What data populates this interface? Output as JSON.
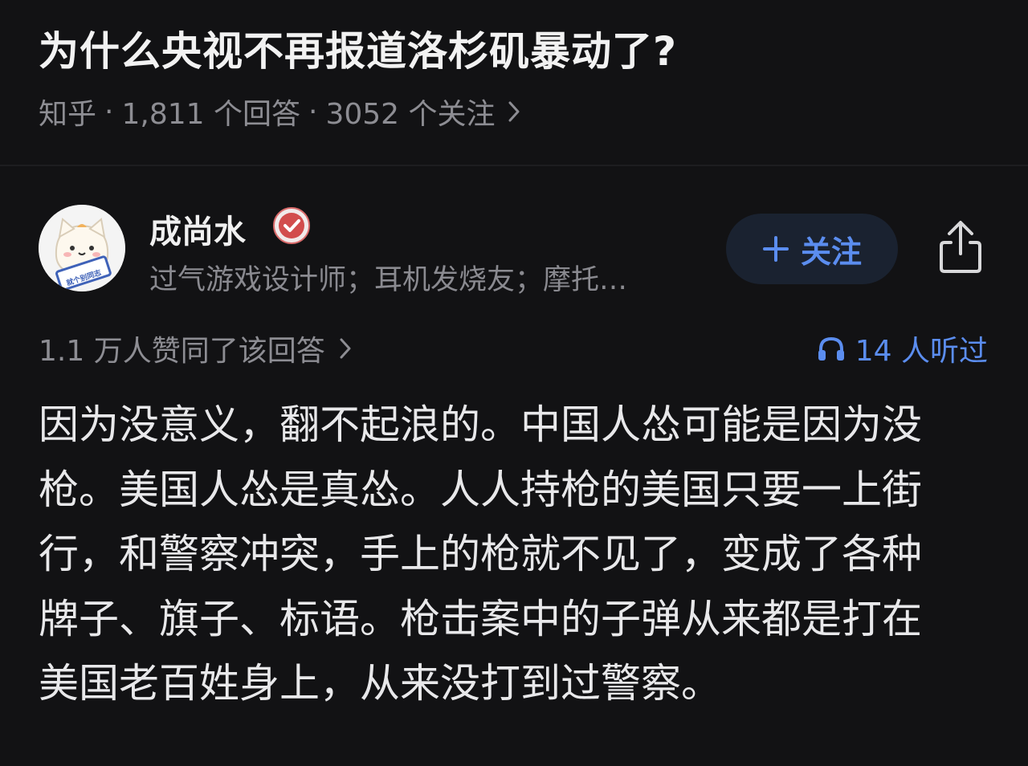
{
  "question": {
    "title": "为什么央视不再报道洛杉矶暴动了?"
  },
  "meta": {
    "source": "知乎",
    "separator": "·",
    "answer_count": "1,811 个回答",
    "follower_count": "3052 个关注"
  },
  "author": {
    "name": "成尚水",
    "bio": "过气游戏设计师；耳机发烧友；摩托…",
    "avatar_caption": "就个别同志",
    "avatar_icon": "cat-avatar-icon"
  },
  "actions": {
    "follow_label": "关注",
    "follow_icon": "plus-icon",
    "share_icon": "share-icon"
  },
  "stats": {
    "likes_text": "1.1 万人赞同了该回答",
    "listen_text": "14 人听过",
    "listen_icon": "headphones-icon"
  },
  "answer": {
    "lines": [
      "因为没意义，翻不起浪的。中国人怂可能是因为没",
      "枪。美国人怂是真怂。人人持枪的美国只要一上街",
      "行，和警察冲突，手上的枪就不见了，变成了各种",
      "牌子、旗子、标语。枪击案中的子弹从来都是打在",
      "美国老百姓身上，从来没打到过警察。"
    ]
  },
  "colors": {
    "background": "#121214",
    "accent": "#5b8def",
    "muted": "#8d8d93"
  }
}
